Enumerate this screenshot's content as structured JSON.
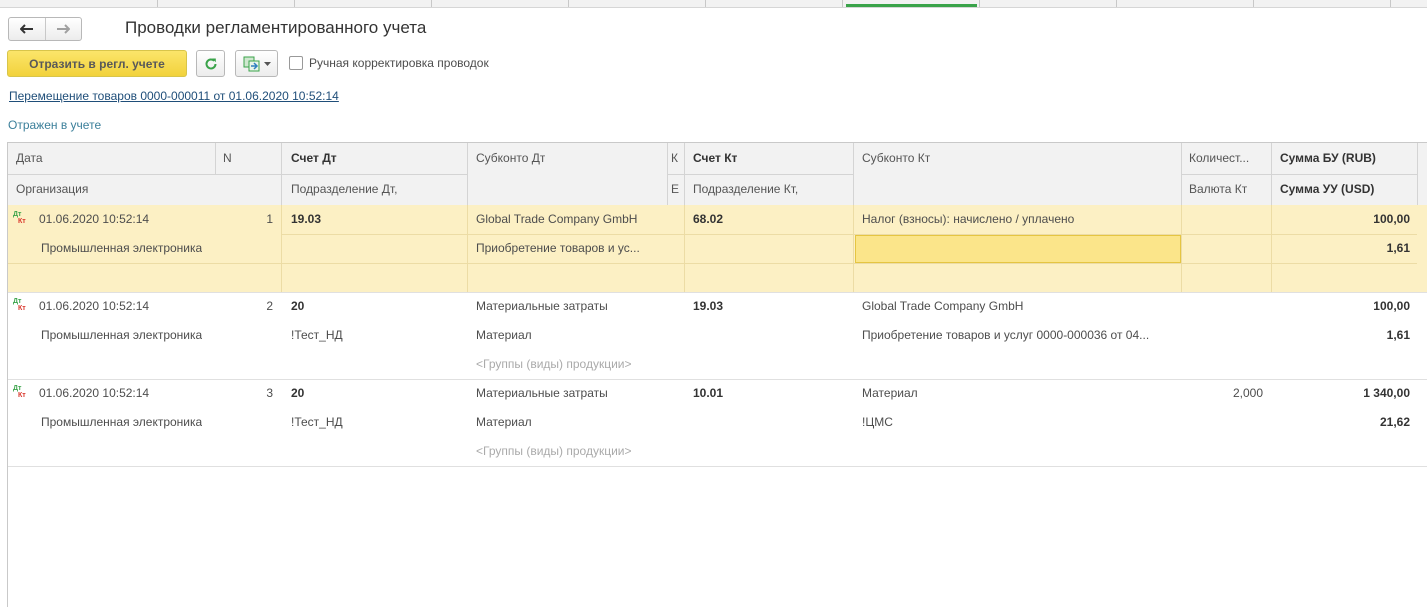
{
  "window": {
    "title": "Проводки регламентированного учета"
  },
  "nav": {
    "back": "🡐",
    "forward": "🡒"
  },
  "toolbar": {
    "reflect_label": "Отразить в регл. учете",
    "manual_label": "Ручная корректировка проводок",
    "manual_checked": false
  },
  "document_link": "Перемещение товаров 0000-000011 от 01.06.2020 10:52:14",
  "status": "Отражен в учете",
  "columns": {
    "date": "Дата",
    "n": "N",
    "acc_dt": "Счет Дт",
    "sub_dt": "Субконто Дт",
    "k": "К",
    "acc_kt": "Счет Кт",
    "sub_kt": "Субконто Кт",
    "qty": "Количест...",
    "sum_bu": "Сумма БУ (RUB)",
    "org": "Организация",
    "dept_dt": "Подразделение Дт,",
    "e": "Е",
    "dept_kt": "Подразделение Кт,",
    "cur_kt": "Валюта Кт",
    "sum_uu": "Сумма УУ (USD)"
  },
  "rows": [
    {
      "date": "01.06.2020 10:52:14",
      "n": "1",
      "org": "Промышленная электроника",
      "acc_dt": "19.03",
      "dept_dt": "",
      "sub_dt1": "Global Trade Company GmbH",
      "sub_dt2": "Приобретение товаров и ус...",
      "sub_dt3": "",
      "acc_kt": "68.02",
      "sub_kt1": "Налог (взносы): начислено / уплачено",
      "sub_kt2": "",
      "qty": "",
      "sum_bu": "100,00",
      "sum_uu": "1,61"
    },
    {
      "date": "01.06.2020 10:52:14",
      "n": "2",
      "org": "Промышленная электроника",
      "acc_dt": "20",
      "dept_dt": "!Тест_НД",
      "sub_dt1": "Материальные затраты",
      "sub_dt2": "Материал",
      "sub_dt3": "<Группы (виды) продукции>",
      "acc_kt": "19.03",
      "sub_kt1": "Global Trade Company GmbH",
      "sub_kt2": "Приобретение товаров и услуг 0000-000036 от 04...",
      "qty": "",
      "sum_bu": "100,00",
      "sum_uu": "1,61"
    },
    {
      "date": "01.06.2020 10:52:14",
      "n": "3",
      "org": "Промышленная электроника",
      "acc_dt": "20",
      "dept_dt": "!Тест_НД",
      "sub_dt1": "Материальные затраты",
      "sub_dt2": "Материал",
      "sub_dt3": "<Группы (виды) продукции>",
      "acc_kt": "10.01",
      "sub_kt1": "Материал",
      "sub_kt2": "!ЦМС",
      "qty": "2,000",
      "sum_bu": "1 340,00",
      "sum_uu": "21,62"
    }
  ],
  "icons": {
    "entry": "dt-kt-icon",
    "refresh": "refresh-icon",
    "copy": "copy-icon",
    "dropdown": "dropdown-arrow-icon"
  },
  "colors": {
    "accent_green": "#3aa34a",
    "selected_row": "#fcf0c4",
    "primary_button": "#f2d23c"
  }
}
